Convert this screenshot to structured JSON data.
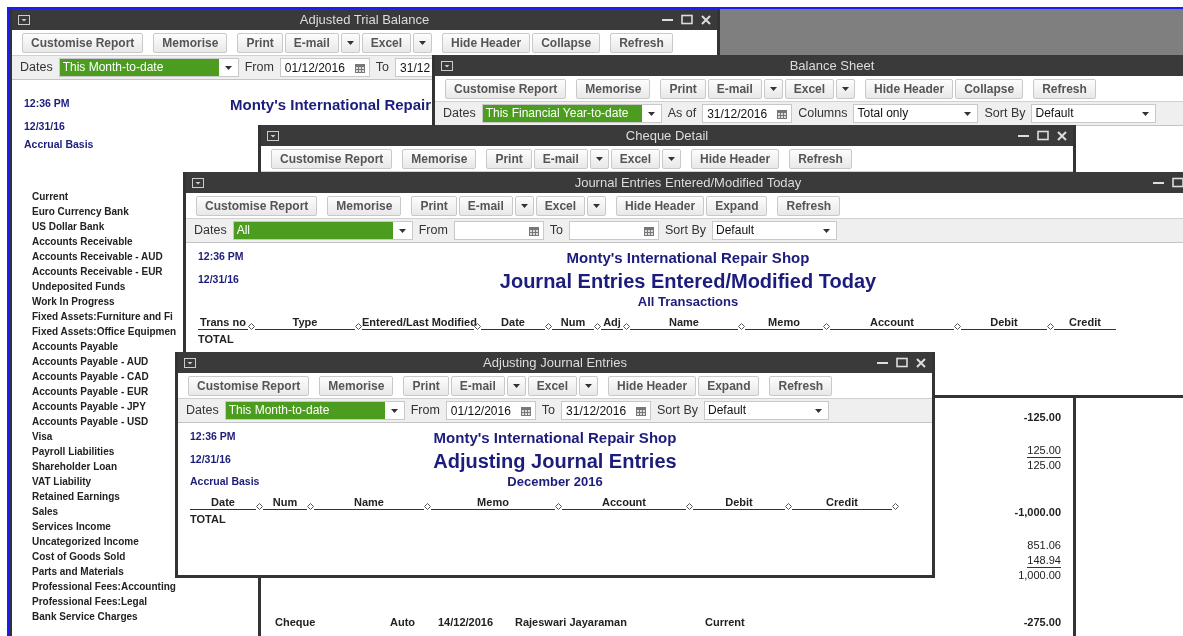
{
  "windows": [
    {
      "title": "Adjusted Trial Balance",
      "toolbar": [
        {
          "buttons": [
            {
              "label": "Customise Report"
            }
          ]
        },
        {
          "buttons": [
            {
              "label": "Memorise"
            }
          ]
        },
        {
          "buttons": [
            {
              "label": "Print"
            },
            {
              "label": "E-mail",
              "dropdown": true
            },
            {
              "label": "Excel",
              "dropdown": true
            }
          ]
        },
        {
          "buttons": [
            {
              "label": "Hide Header"
            },
            {
              "label": "Collapse"
            }
          ]
        },
        {
          "buttons": [
            {
              "label": "Refresh"
            }
          ]
        }
      ],
      "filters": [
        {
          "kind": "label",
          "text": "Dates"
        },
        {
          "kind": "select",
          "value": "This Month-to-date",
          "highlighted": true
        },
        {
          "kind": "label",
          "text": "From"
        },
        {
          "kind": "date",
          "value": "01/12/2016"
        },
        {
          "kind": "label",
          "text": "To"
        },
        {
          "kind": "text",
          "value": "31/12"
        }
      ],
      "report": {
        "time": "12:36 PM",
        "date": "12/31/16",
        "basis": "Accrual Basis",
        "company": "Monty's International Repair"
      },
      "accounts": [
        "Current",
        "Euro Currency Bank",
        "US Dollar Bank",
        "Accounts Receivable",
        "Accounts Receivable - AUD",
        "Accounts Receivable - EUR",
        "Undeposited Funds",
        "Work In Progress",
        "Fixed Assets:Furniture and Fi",
        "Fixed Assets:Office Equipmen",
        "Accounts Payable",
        "Accounts Payable - AUD",
        "Accounts Payable - CAD",
        "Accounts Payable - EUR",
        "Accounts Payable - JPY",
        "Accounts Payable - USD",
        "Visa",
        "Payroll Liabilities",
        "Shareholder Loan",
        "VAT Liability",
        "Retained Earnings",
        "Sales",
        "Services Income",
        "Uncategorized Income",
        "Cost of Goods Sold",
        "Parts and Materials",
        "Professional Fees:Accounting",
        "Professional Fees:Legal",
        "Bank Service Charges"
      ]
    },
    {
      "title": "Balance Sheet",
      "toolbar": [
        {
          "buttons": [
            {
              "label": "Customise Report"
            }
          ]
        },
        {
          "buttons": [
            {
              "label": "Memorise"
            }
          ]
        },
        {
          "buttons": [
            {
              "label": "Print"
            },
            {
              "label": "E-mail",
              "dropdown": true
            },
            {
              "label": "Excel",
              "dropdown": true
            }
          ]
        },
        {
          "buttons": [
            {
              "label": "Hide Header"
            },
            {
              "label": "Collapse"
            }
          ]
        },
        {
          "buttons": [
            {
              "label": "Refresh"
            }
          ]
        }
      ],
      "filters": [
        {
          "kind": "label",
          "text": "Dates"
        },
        {
          "kind": "select",
          "value": "This Financial Year-to-date",
          "highlighted": true
        },
        {
          "kind": "label",
          "text": "As of"
        },
        {
          "kind": "date",
          "value": "31/12/2016"
        },
        {
          "kind": "label",
          "text": "Columns"
        },
        {
          "kind": "select",
          "value": "Total only",
          "highlighted": false
        },
        {
          "kind": "label",
          "text": "Sort By"
        },
        {
          "kind": "select",
          "value": "Default",
          "highlighted": false
        }
      ]
    },
    {
      "title": "Cheque Detail",
      "toolbar": [
        {
          "buttons": [
            {
              "label": "Customise Report"
            }
          ]
        },
        {
          "buttons": [
            {
              "label": "Memorise"
            }
          ]
        },
        {
          "buttons": [
            {
              "label": "Print"
            },
            {
              "label": "E-mail",
              "dropdown": true
            },
            {
              "label": "Excel",
              "dropdown": true
            }
          ]
        },
        {
          "buttons": [
            {
              "label": "Hide Header"
            }
          ]
        },
        {
          "buttons": [
            {
              "label": "Refresh"
            }
          ]
        }
      ],
      "rows": [
        {
          "kind": "total",
          "amount": "-125.00"
        },
        {
          "kind": "line",
          "amount": "125.00",
          "underline": true
        },
        {
          "kind": "line",
          "amount": "125.00"
        },
        {
          "kind": "total",
          "amount": "-1,000.00"
        },
        {
          "kind": "line",
          "amount": "851.06"
        },
        {
          "kind": "line",
          "amount": "148.94",
          "underline": true
        },
        {
          "kind": "line",
          "amount": "1,000.00"
        },
        {
          "kind": "transaction",
          "type": "Cheque",
          "num": "Auto",
          "date": "14/12/2016",
          "name": "Rajeswari Jayaraman",
          "account": "Current",
          "amount": "-275.00"
        }
      ]
    },
    {
      "title": "Journal Entries Entered/Modified Today",
      "toolbar": [
        {
          "buttons": [
            {
              "label": "Customise Report"
            }
          ]
        },
        {
          "buttons": [
            {
              "label": "Memorise"
            }
          ]
        },
        {
          "buttons": [
            {
              "label": "Print"
            },
            {
              "label": "E-mail",
              "dropdown": true
            },
            {
              "label": "Excel",
              "dropdown": true
            }
          ]
        },
        {
          "buttons": [
            {
              "label": "Hide Header"
            },
            {
              "label": "Expand"
            }
          ]
        },
        {
          "buttons": [
            {
              "label": "Refresh"
            }
          ]
        }
      ],
      "filters": [
        {
          "kind": "label",
          "text": "Dates"
        },
        {
          "kind": "select",
          "value": "All",
          "highlighted": true
        },
        {
          "kind": "label",
          "text": "From"
        },
        {
          "kind": "date"
        },
        {
          "kind": "label",
          "text": "To"
        },
        {
          "kind": "date"
        },
        {
          "kind": "label",
          "text": "Sort By"
        },
        {
          "kind": "select",
          "value": "Default",
          "highlighted": false
        }
      ],
      "report": {
        "time": "12:36 PM",
        "date": "12/31/16",
        "company": "Monty's International Repair Shop",
        "title": "Journal Entries Entered/Modified Today",
        "subtitle": "All Transactions",
        "columns": [
          "Trans no",
          "Type",
          "Entered/Last Modified",
          "Date",
          "Num",
          "Adj",
          "Name",
          "Memo",
          "Account",
          "Debit",
          "Credit"
        ],
        "trailing_marker": false,
        "total": "TOTAL"
      }
    },
    {
      "title": "Adjusting Journal Entries",
      "toolbar": [
        {
          "buttons": [
            {
              "label": "Customise Report"
            }
          ]
        },
        {
          "buttons": [
            {
              "label": "Memorise"
            }
          ]
        },
        {
          "buttons": [
            {
              "label": "Print"
            },
            {
              "label": "E-mail",
              "dropdown": true
            },
            {
              "label": "Excel",
              "dropdown": true
            }
          ]
        },
        {
          "buttons": [
            {
              "label": "Hide Header"
            },
            {
              "label": "Expand"
            }
          ]
        },
        {
          "buttons": [
            {
              "label": "Refresh"
            }
          ]
        }
      ],
      "filters": [
        {
          "kind": "label",
          "text": "Dates"
        },
        {
          "kind": "select",
          "value": "This Month-to-date",
          "highlighted": true
        },
        {
          "kind": "label",
          "text": "From"
        },
        {
          "kind": "date",
          "value": "01/12/2016"
        },
        {
          "kind": "label",
          "text": "To"
        },
        {
          "kind": "date",
          "value": "31/12/2016"
        },
        {
          "kind": "label",
          "text": "Sort By"
        },
        {
          "kind": "select",
          "value": "Default",
          "highlighted": false
        }
      ],
      "report": {
        "time": "12:36 PM",
        "date": "12/31/16",
        "basis": "Accrual Basis",
        "company": "Monty's International Repair Shop",
        "title": "Adjusting Journal Entries",
        "subtitle": "December 2016",
        "columns": [
          "Date",
          "Num",
          "Name",
          "Memo",
          "Account",
          "Debit",
          "Credit"
        ],
        "trailing_marker": true,
        "total": "TOTAL"
      }
    }
  ]
}
